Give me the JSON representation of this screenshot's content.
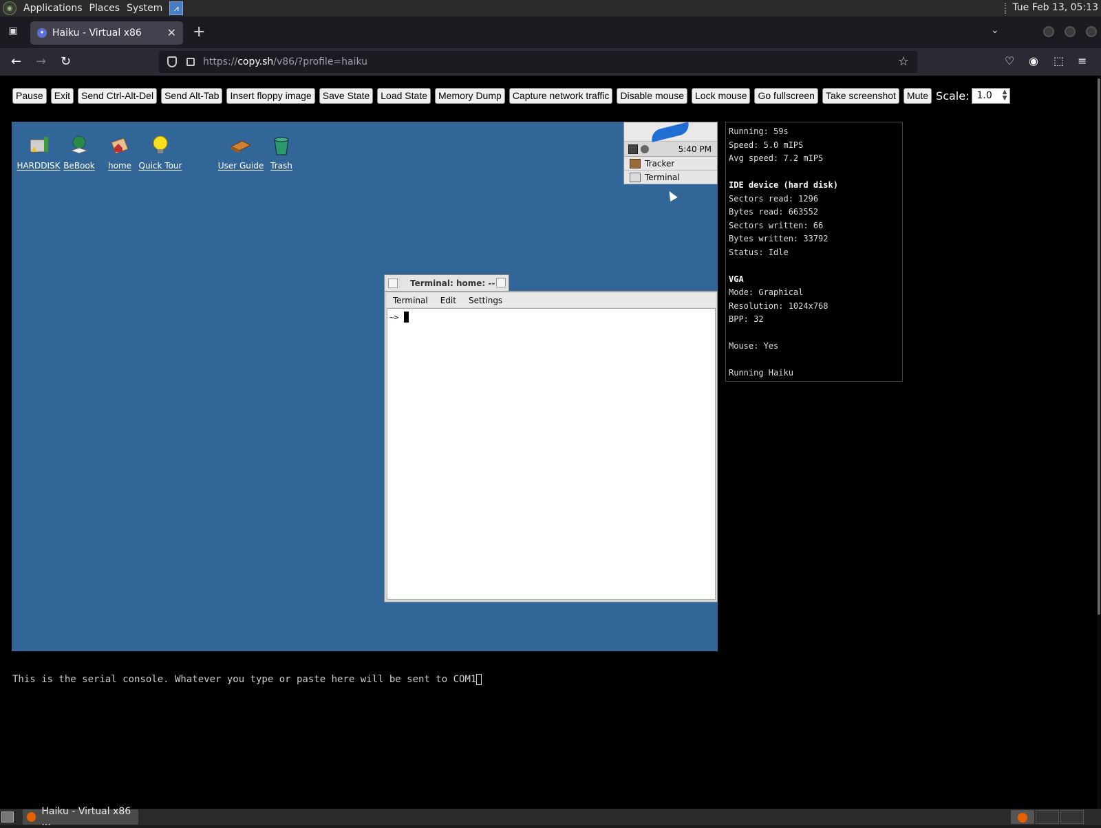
{
  "top_panel": {
    "menus": [
      "Applications",
      "Places",
      "System"
    ],
    "clock": "Tue Feb 13, 05:13"
  },
  "browser": {
    "tab_title": "Haiku - Virtual x86",
    "url_host": "copy.sh",
    "url_prefix": "https://",
    "url_path": "/v86/?profile=haiku"
  },
  "toolbar": {
    "buttons": [
      "Pause",
      "Exit",
      "Send Ctrl-Alt-Del",
      "Send Alt-Tab",
      "Insert floppy image",
      "Save State",
      "Load State",
      "Memory Dump",
      "Capture network traffic",
      "Disable mouse",
      "Lock mouse",
      "Go fullscreen",
      "Take screenshot",
      "Mute"
    ],
    "scale_label": "Scale:",
    "scale_value": "1.0"
  },
  "vm": {
    "desktop_icons": [
      "HARDDISK",
      "BeBook",
      "home",
      "Quick Tour",
      "User Guide",
      "Trash"
    ],
    "deskbar": {
      "time": "5:40 PM",
      "apps": [
        "Tracker",
        "Terminal"
      ]
    },
    "terminal": {
      "title": "Terminal: home: --",
      "menu": [
        "Terminal",
        "Edit",
        "Settings"
      ],
      "prompt": "~>"
    }
  },
  "stats": {
    "running": "Running: 59s",
    "speed": "Speed: 5.0 mIPS",
    "avg_speed": "Avg speed: 7.2 mIPS",
    "ide_header": "IDE device (hard disk)",
    "sectors_read": "Sectors read: 1296",
    "bytes_read": "Bytes read: 663552",
    "sectors_written": "Sectors written: 66",
    "bytes_written": "Bytes written: 33792",
    "status": "Status: Idle",
    "vga_header": "VGA",
    "mode": "Mode: Graphical",
    "resolution": "Resolution: 1024x768",
    "bpp": "BPP: 32",
    "mouse": "Mouse: Yes",
    "running_os": "Running Haiku"
  },
  "serial": {
    "text": "This is the serial console. Whatever you type or paste here will be sent to COM1"
  },
  "bottom_panel": {
    "task_title": "Haiku - Virtual x86 ..."
  }
}
